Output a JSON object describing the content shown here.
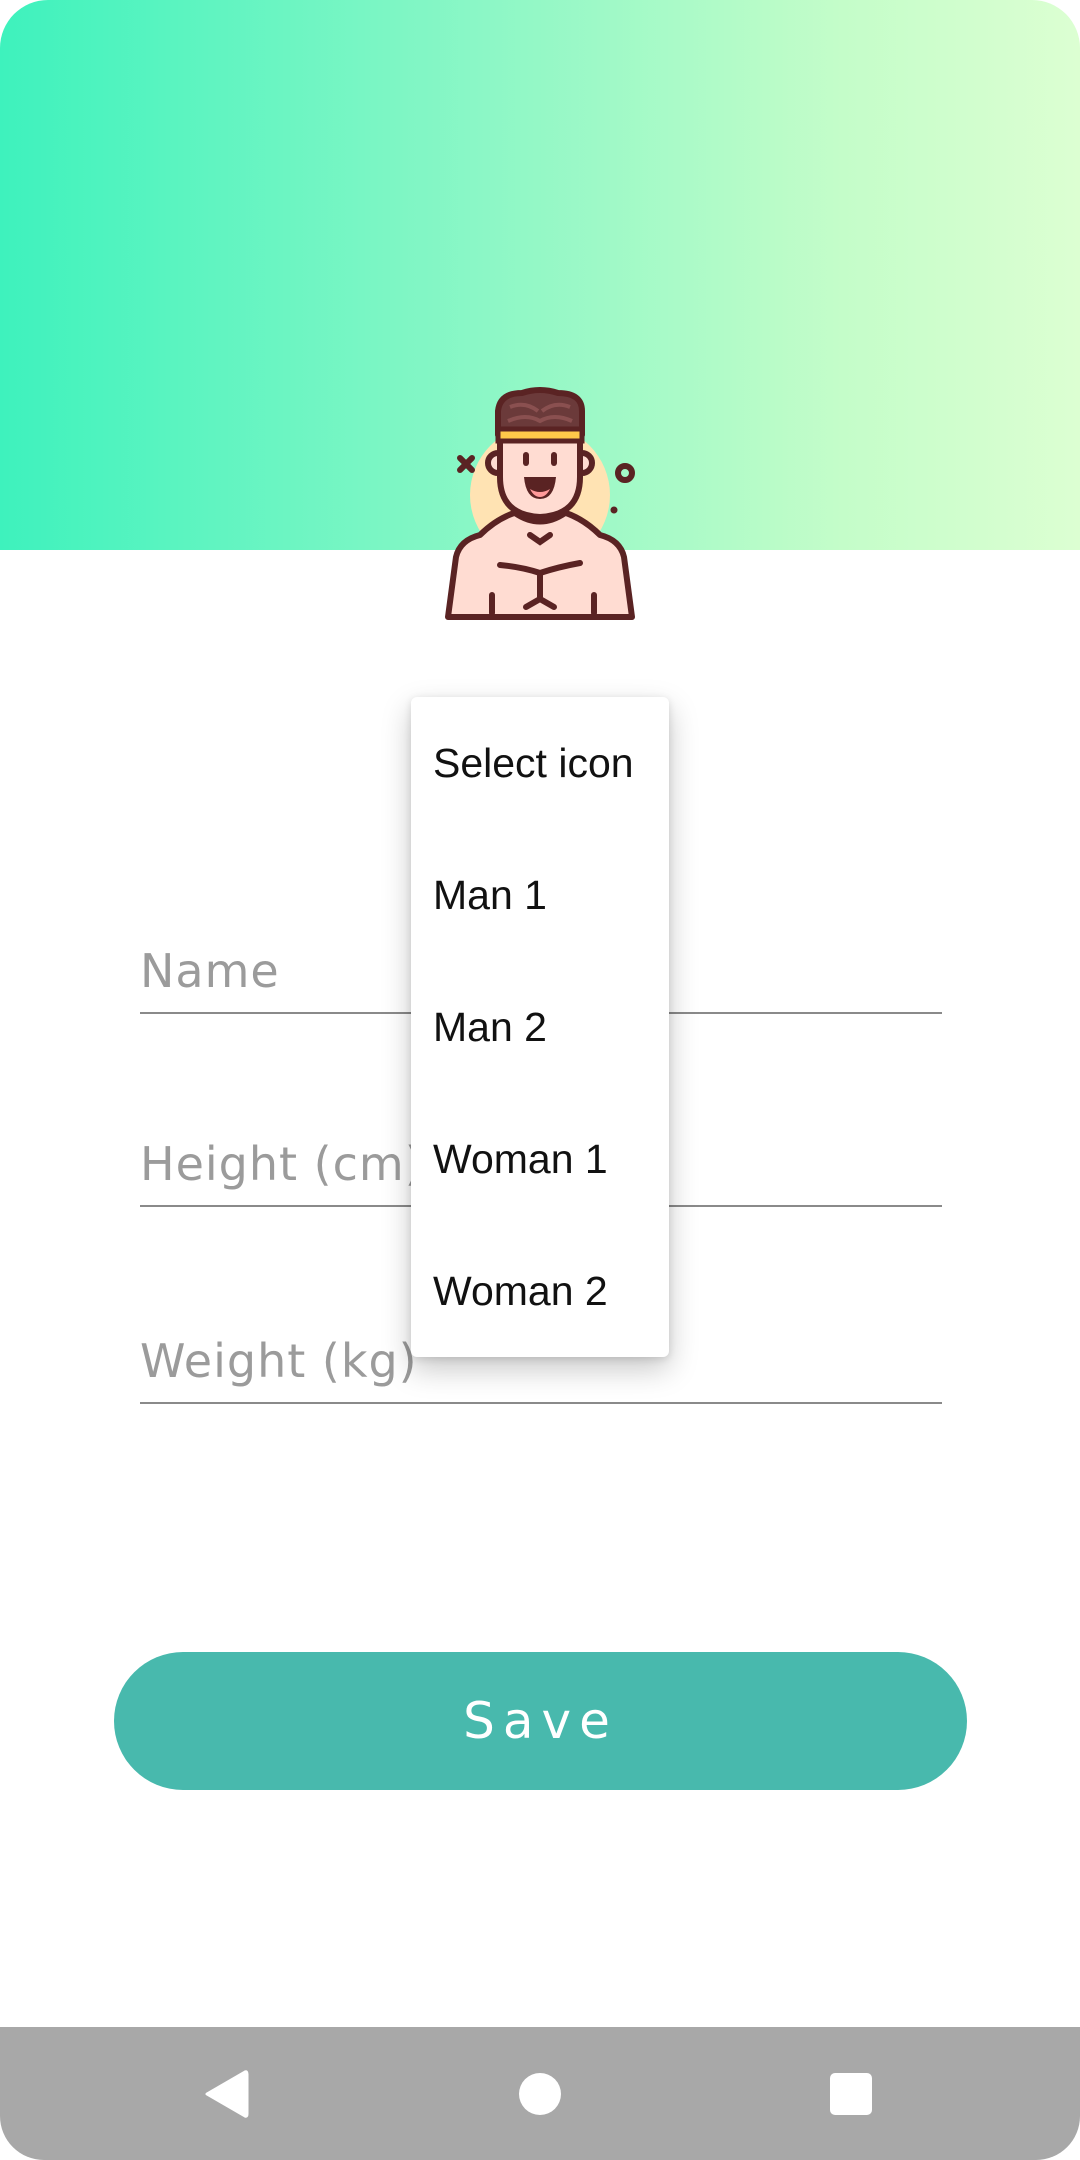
{
  "form": {
    "name_placeholder": "Name",
    "height_placeholder": "Height (cm)",
    "weight_placeholder": "Weight (kg)",
    "save_label": "Save"
  },
  "icon_dropdown": {
    "options": [
      "Select icon",
      "Man 1",
      "Man 2",
      "Woman 1",
      "Woman 2"
    ]
  },
  "avatar": {
    "icon": "man-avatar-icon"
  },
  "navbar": {
    "back_icon": "back-triangle-icon",
    "home_icon": "home-circle-icon",
    "recents_icon": "recents-square-icon"
  },
  "colors": {
    "header_gradient_start": "#3ef2bd",
    "header_gradient_end": "#dcffd2",
    "save_button": "#48b9ad",
    "navbar": "#a8a8a8"
  }
}
